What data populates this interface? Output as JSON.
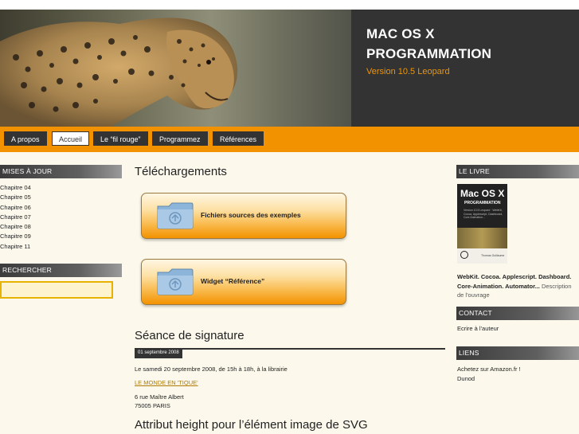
{
  "header": {
    "title_line1": "MAC OS X",
    "title_line2": "PROGRAMMATION",
    "subtitle": "Version 10.5 Leopard"
  },
  "nav": {
    "items": [
      "A propos",
      "Accueil",
      "Le “fil rouge”",
      "Programmez",
      "Références"
    ],
    "active": "Accueil"
  },
  "left": {
    "updates_title": "MISES À JOUR",
    "updates": [
      "Chapitre 04",
      "Chapitre 05",
      "Chapitre 06",
      "Chapitre 07",
      "Chapitre 08",
      "Chapitre 09",
      "Chapitre 11"
    ],
    "search_title": "RECHERCHER",
    "search_value": ""
  },
  "main": {
    "downloads_title": "Téléchargements",
    "download1": "Fichiers sources des exemples",
    "download2": "Widget “Référence”",
    "post_title": "Séance de signature",
    "post_date": "01 septembre 2008",
    "post_line": "Le samedi 20 septembre 2008, de 15h à 18h, à la librairie",
    "post_link": "LE MONDE EN 'TIQUE'",
    "address1": "6 rue Maître Albert",
    "address2": "75005 PARIS",
    "next_title": "Attribut height pour l’élément image de SVG"
  },
  "right": {
    "book_title": "LE LIVRE",
    "cover_title1": "Mac OS X",
    "cover_title2": "PROGRAMMATION",
    "cover_subtitle": "Version 10.5 Leopard · WebKit, Cocoa, Applescript, Dashboard, Core Animation...",
    "cover_author": "Thomas Guillaume",
    "desc_bold1": "WebKit. Cocoa. Applescript. Dashboard.",
    "desc_bold2": "Core-Animation. Automator...",
    "desc_gray": " Description de l'ouvrage",
    "contact_title": "CONTACT",
    "contact_text": "Ecrire à l'auteur",
    "links_title": "LIENS",
    "links": [
      "Achetez sur Amazon.fr !",
      "Dunod"
    ]
  },
  "colors": {
    "accent": "#f39200",
    "dark": "#333333",
    "background": "#fcf9ec"
  }
}
